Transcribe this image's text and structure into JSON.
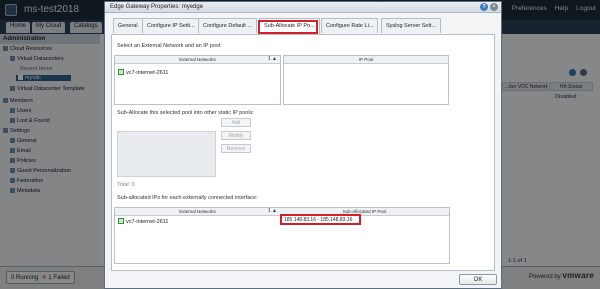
{
  "app": {
    "title": "ms-test2018",
    "top_links": [
      "Preferences",
      "Help",
      "Logout"
    ],
    "tabs": [
      "Home",
      "My Cloud",
      "Catalogs"
    ]
  },
  "sidebar": {
    "header": "Administration",
    "items": [
      "Cloud Resources",
      "Virtual Datacenters",
      "Recent Items",
      "myvdc",
      "Virtual Datacenter Template",
      "Members",
      "Users",
      "Lost & Found",
      "Settings",
      "General",
      "Email",
      "Policies",
      "Guest Personalization",
      "Federation",
      "Metadata"
    ]
  },
  "background_table": {
    "columns": [
      "...ber VDC Networks",
      "HA Status"
    ],
    "values": [
      "Disabled"
    ],
    "pager": "1-1 of 1"
  },
  "status": {
    "running": "0 Running",
    "failed": "1 Failed",
    "powered_by": "Powered by",
    "brand": "vmware"
  },
  "dialog": {
    "title": "Edge Gateway Properties: myedge",
    "help": "?",
    "close": "×",
    "tabs": [
      "General",
      "Configure IP Setti...",
      "Configure Default ...",
      "Sub-Allocate IP Po...",
      "Configure Rate Li...",
      "Syslog Server Sett..."
    ],
    "active_tab": 3,
    "select_prompt": "Select an External Network and an IP pool:",
    "ext_grid": {
      "col_external": "External Networks",
      "sort_mark": "1 ▲",
      "col_ippool": "IP Pool",
      "rows": [
        "vc7-internet-2611"
      ]
    },
    "sub_allocate_prompt": "Sub-Allocate this selected pool into other static IP pools:",
    "buttons": {
      "add": "Add",
      "modify": "Modify",
      "remove": "Remove"
    },
    "total": "Total: 0",
    "sub_allocated_label": "Sub-allocated IPs for each externally connected interface:",
    "sub_grid": {
      "col_external": "External Networks",
      "sort_mark": "1 ▲",
      "col_pool": "Sub-Allocated IP Pool",
      "rows": [
        {
          "network": "vc7-internet-2611",
          "pool": "185.148.83.16 - 185.148.83.16"
        }
      ]
    },
    "ok": "OK"
  }
}
